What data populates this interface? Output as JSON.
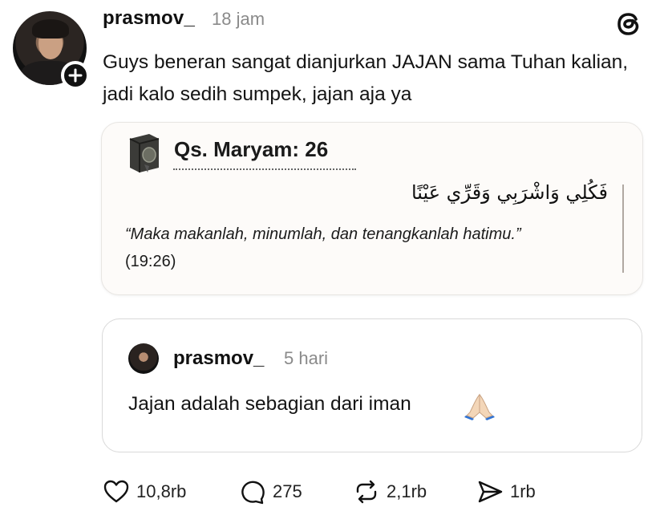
{
  "post": {
    "username": "prasmov_",
    "time": "18 jam",
    "text": "Guys beneran sangat dianjurkan JAJAN sama Tuhan kalian, jadi kalo sedih sumpek, jajan aja ya"
  },
  "card": {
    "title": "Qs. Maryam: 26",
    "arabic": "فَكُلِي وَاشْرَبِي وَقَرِّي عَيْنًا",
    "translation_quote": "“Maka makanlah, minumlah, dan tenangkanlah hatimu.”",
    "reference": " (19:26)"
  },
  "reply": {
    "username": "prasmov_",
    "time": "5 hari",
    "text": "Jajan adalah sebagian dari iman"
  },
  "actions": {
    "likes": "10,8rb",
    "comments": "275",
    "reposts": "2,1rb",
    "shares": "1rb"
  },
  "icons": {
    "logo": "threads-logo-icon",
    "follow": "plus-icon",
    "card": "book-icon",
    "emoji": "praying-hands-icon",
    "like": "heart-icon",
    "comment": "comment-icon",
    "repost": "repost-icon",
    "share": "send-icon"
  },
  "colors": {
    "text": "#111111",
    "muted": "#8a8a8a",
    "card_bg": "#fdfbf9",
    "border": "#d9d9d9"
  }
}
